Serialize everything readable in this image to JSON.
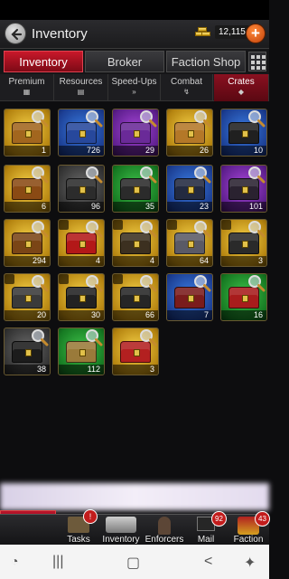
{
  "header": {
    "title": "Inventory",
    "gold": "12,115"
  },
  "main_tabs": [
    "Inventory",
    "Broker",
    "Faction Shop"
  ],
  "sub_tabs": [
    "Premium",
    "Resources",
    "Speed-Ups",
    "Combat",
    "Crates"
  ],
  "items": [
    {
      "qty": "1",
      "bg": "gold",
      "chest": "#a2661e"
    },
    {
      "qty": "726",
      "bg": "blue",
      "chest": "#27489c"
    },
    {
      "qty": "29",
      "bg": "purple",
      "chest": "#6a2a98"
    },
    {
      "qty": "26",
      "bg": "gold",
      "chest": "#b47828"
    },
    {
      "qty": "10",
      "bg": "blue",
      "chest": "#202020"
    },
    {
      "qty": "6",
      "bg": "gold",
      "chest": "#8a4a14"
    },
    {
      "qty": "96",
      "bg": "gray",
      "chest": "#2c2c2c"
    },
    {
      "qty": "35",
      "bg": "green",
      "chest": "#2b2b2b"
    },
    {
      "qty": "23",
      "bg": "blue",
      "chest": "#232a40"
    },
    {
      "qty": "101",
      "bg": "purple",
      "chest": "#2a2230"
    },
    {
      "qty": "294",
      "bg": "gold",
      "chest": "#7a4516"
    },
    {
      "qty": "4",
      "bg": "gold",
      "chest": "#b31818",
      "tag": true
    },
    {
      "qty": "4",
      "bg": "gold",
      "chest": "#3c3020",
      "tag": true
    },
    {
      "qty": "64",
      "bg": "gold",
      "chest": "#5a5a66",
      "tag": true
    },
    {
      "qty": "3",
      "bg": "gold",
      "chest": "#2a2a2a",
      "tag": true
    },
    {
      "qty": "20",
      "bg": "gold",
      "chest": "#3a3a3a",
      "tag": true
    },
    {
      "qty": "30",
      "bg": "gold",
      "chest": "#222222",
      "tag": true
    },
    {
      "qty": "66",
      "bg": "gold",
      "chest": "#262626",
      "tag": true
    },
    {
      "qty": "7",
      "bg": "blue",
      "chest": "#7a1c1c"
    },
    {
      "qty": "16",
      "bg": "green",
      "chest": "#a81c1c"
    },
    {
      "qty": "38",
      "bg": "gray",
      "chest": "#1c1c1c"
    },
    {
      "qty": "112",
      "bg": "green",
      "chest": "#9a7a3a"
    },
    {
      "qty": "3",
      "bg": "gold",
      "chest": "#b32020"
    }
  ],
  "bottom_nav": [
    {
      "label": "Tasks",
      "badge": "!"
    },
    {
      "label": "Inventory"
    },
    {
      "label": "Enforcers"
    },
    {
      "label": "Mail",
      "badge": "92"
    },
    {
      "label": "Faction",
      "badge": "43"
    }
  ],
  "colors": {
    "accent_red": "#c8182a",
    "gold": "#f6d248"
  }
}
